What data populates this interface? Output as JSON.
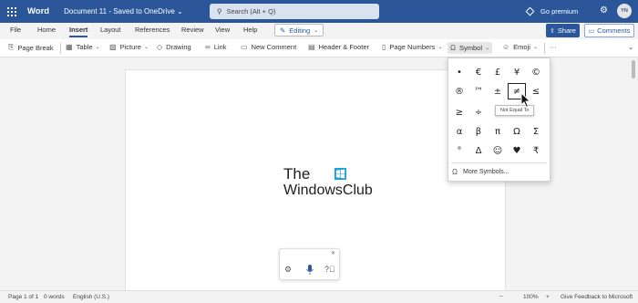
{
  "titlebar": {
    "app_name": "Word",
    "doc_title": "Document 11  -  Saved to OneDrive",
    "doc_title_chevron": "⌄",
    "search_placeholder": "Search (Alt + Q)",
    "go_premium": "Go premium",
    "avatar_initials": "YN",
    "background_color": "#2b579a"
  },
  "menu": {
    "tabs": [
      "File",
      "Home",
      "Insert",
      "Layout",
      "References",
      "Review",
      "View",
      "Help"
    ],
    "active_tab": "Insert",
    "editing_label": "Editing",
    "share_label": "Share",
    "comments_label": "Comments"
  },
  "ribbon": {
    "page_break": "Page Break",
    "table": "Table",
    "picture": "Picture",
    "drawing": "Drawing",
    "link": "Link",
    "new_comment": "New Comment",
    "header_footer": "Header & Footer",
    "page_numbers": "Page Numbers",
    "symbol": "Symbol",
    "emoji": "Emoji",
    "more": "···"
  },
  "document": {
    "logo_line1": "The",
    "logo_line2": "WindowsClub"
  },
  "symbol_panel": {
    "symbols": [
      "•",
      "€",
      "£",
      "¥",
      "©",
      "®",
      "™",
      "±",
      "≠",
      "≤",
      "≥",
      "÷",
      "",
      "",
      "",
      "α",
      "β",
      "π",
      "Ω",
      "Σ",
      "°",
      "Δ",
      "☺",
      "♥",
      "₹"
    ],
    "highlighted_symbol": "≠",
    "tooltip": "Not Equal To",
    "more_symbols": "More Symbols..."
  },
  "status": {
    "page": "Page 1 of 1",
    "words": "0 words",
    "language": "English (U.S.)",
    "zoom": "100%",
    "feedback": "Give Feedback to Microsoft"
  }
}
